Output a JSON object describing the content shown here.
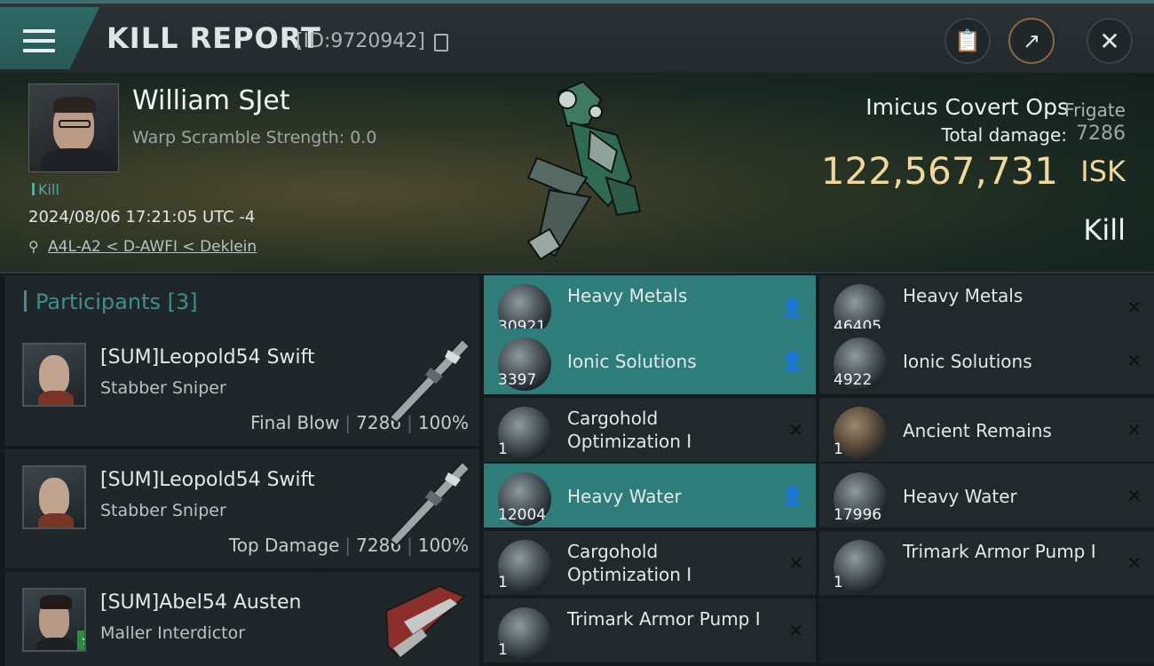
{
  "header": {
    "title": "KILL REPORT",
    "report_id": "[ID:9720942]"
  },
  "victim": {
    "name": "William SJet",
    "warp_scramble": "Warp Scramble Strength: 0.0",
    "tag": "Kill",
    "datetime": "2024/08/06 17:21:05 UTC -4",
    "location": "A4L-A2 < D-AWFI < Deklein",
    "ship_name": "Imicus Covert Ops",
    "ship_class": "Frigate",
    "total_damage_label": "Total damage:",
    "total_damage": "7286",
    "isk_value": "122,567,731",
    "isk_unit": "ISK",
    "result": "Kill"
  },
  "participants": {
    "title": "Participants",
    "count": "[3]",
    "list": [
      {
        "name": "[SUM]Leopold54 Swift",
        "ship": "Stabber Sniper",
        "role": "Final Blow",
        "damage": "7286",
        "percent": "100%"
      },
      {
        "name": "[SUM]Leopold54 Swift",
        "ship": "Stabber Sniper",
        "role": "Top Damage",
        "damage": "7286",
        "percent": "100%"
      },
      {
        "name": "[SUM]Abel54 Austen",
        "ship": "Maller Interdictor"
      }
    ]
  },
  "items": {
    "left": [
      {
        "qty": "30921",
        "name": "Heavy Metals",
        "status": "dropped",
        "icon": "metals-icon"
      },
      {
        "qty": "3397",
        "name": "Ionic Solutions",
        "status": "dropped",
        "icon": "solutions-icon"
      },
      {
        "qty": "1",
        "name": "Cargohold Optimization I",
        "status": "destroyed",
        "icon": "rig-icon"
      },
      {
        "qty": "12004",
        "name": "Heavy Water",
        "status": "dropped",
        "icon": "water-icon"
      },
      {
        "qty": "1",
        "name": "Cargohold Optimization I",
        "status": "destroyed",
        "icon": "rig-icon"
      },
      {
        "qty": "1",
        "name": "Trimark Armor Pump I",
        "status": "destroyed",
        "icon": "armor-rig-icon"
      }
    ],
    "right": [
      {
        "qty": "46405",
        "name": "Heavy Metals",
        "status": "destroyed",
        "icon": "metals-icon"
      },
      {
        "qty": "4922",
        "name": "Ionic Solutions",
        "status": "destroyed",
        "icon": "solutions-icon"
      },
      {
        "qty": "1",
        "name": "Ancient Remains",
        "status": "destroyed",
        "icon": "remains-icon"
      },
      {
        "qty": "17996",
        "name": "Heavy Water",
        "status": "destroyed",
        "icon": "water-icon"
      },
      {
        "qty": "1",
        "name": "Trimark Armor Pump I",
        "status": "destroyed",
        "icon": "armor-rig-icon"
      }
    ]
  },
  "colors": {
    "accent_teal": "#2e7d7a",
    "isk_gold": "#f0d79a",
    "panel": "#21292d"
  }
}
